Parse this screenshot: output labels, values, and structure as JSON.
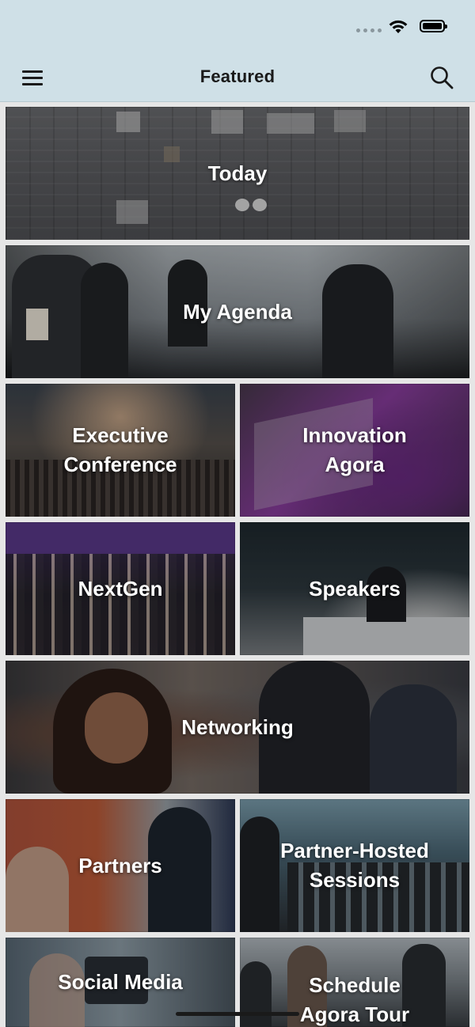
{
  "nav": {
    "title": "Featured",
    "menu_icon": "hamburger-menu-icon",
    "search_icon": "search-icon"
  },
  "tiles": [
    {
      "label": "Today"
    },
    {
      "label": "My Agenda"
    },
    {
      "label": "Executive\nConference"
    },
    {
      "label": "Innovation\nAgora"
    },
    {
      "label": "NextGen"
    },
    {
      "label": "Speakers"
    },
    {
      "label": "Networking"
    },
    {
      "label": "Partners"
    },
    {
      "label": "Partner-Hosted\nSessions"
    },
    {
      "label": "Social Media"
    },
    {
      "label": "Schedule\nAgora Tour"
    }
  ],
  "colors": {
    "header_bg": "#cfe0e7",
    "label_text": "#ffffff"
  }
}
